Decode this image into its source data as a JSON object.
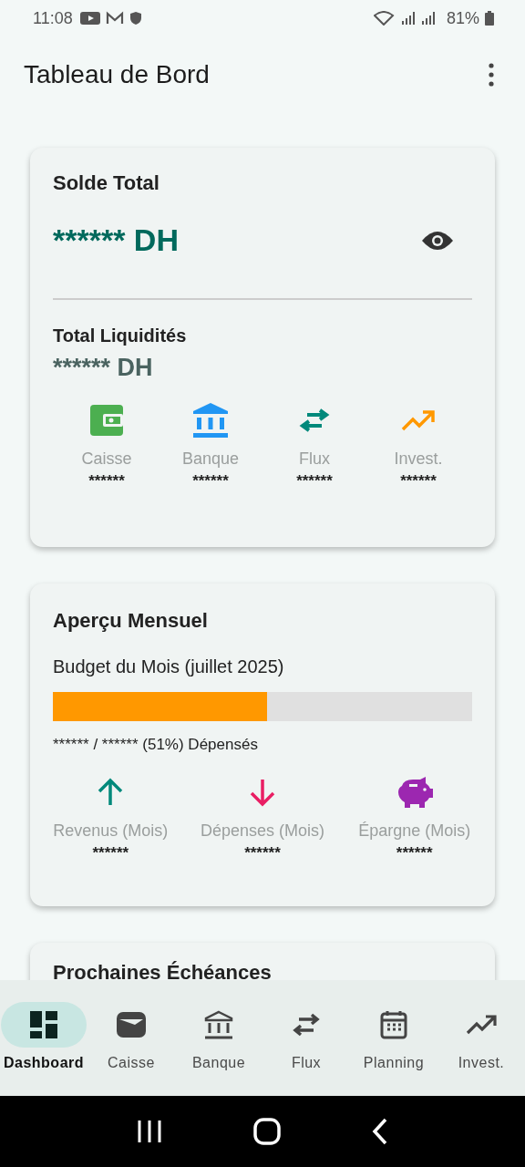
{
  "status_bar": {
    "time": "11:08",
    "battery": "81%"
  },
  "app_bar": {
    "title": "Tableau de Bord"
  },
  "balance_card": {
    "title": "Solde Total",
    "amount": "****** DH",
    "liquidity_label": "Total Liquidités",
    "liquidity_amount": "****** DH",
    "accounts": [
      {
        "kind": "wallet",
        "label": "Caisse",
        "value": "******",
        "color": "#4caf50"
      },
      {
        "kind": "bank",
        "label": "Banque",
        "value": "******",
        "color": "#2196f3"
      },
      {
        "kind": "transfer",
        "label": "Flux",
        "value": "******",
        "color": "#00897b"
      },
      {
        "kind": "trend",
        "label": "Invest.",
        "value": "******",
        "color": "#ff9800"
      }
    ]
  },
  "monthly_card": {
    "title": "Aperçu Mensuel",
    "budget_label": "Budget du Mois (juillet 2025)",
    "level": 0.51,
    "summary": "****** / ****** (51%) Dépensés",
    "stats": [
      {
        "kind": "up",
        "label": "Revenus (Mois)",
        "value": "******",
        "color": "#00897b"
      },
      {
        "kind": "down",
        "label": "Dépenses (Mois)",
        "value": "******",
        "color": "#e91e63"
      },
      {
        "kind": "piggy",
        "label": "Épargne (Mois)",
        "value": "******",
        "color": "#9c27b0"
      }
    ]
  },
  "upcoming_card": {
    "title": "Prochaines Échéances"
  },
  "bottom_nav": [
    {
      "kind": "dashboard",
      "label": "Dashboard",
      "selected": true
    },
    {
      "kind": "wallet",
      "label": "Caisse",
      "selected": false
    },
    {
      "kind": "bank",
      "label": "Banque",
      "selected": false
    },
    {
      "kind": "transfer",
      "label": "Flux",
      "selected": false
    },
    {
      "kind": "calendar",
      "label": "Planning",
      "selected": false
    },
    {
      "kind": "trend",
      "label": "Invest.",
      "selected": false
    }
  ]
}
